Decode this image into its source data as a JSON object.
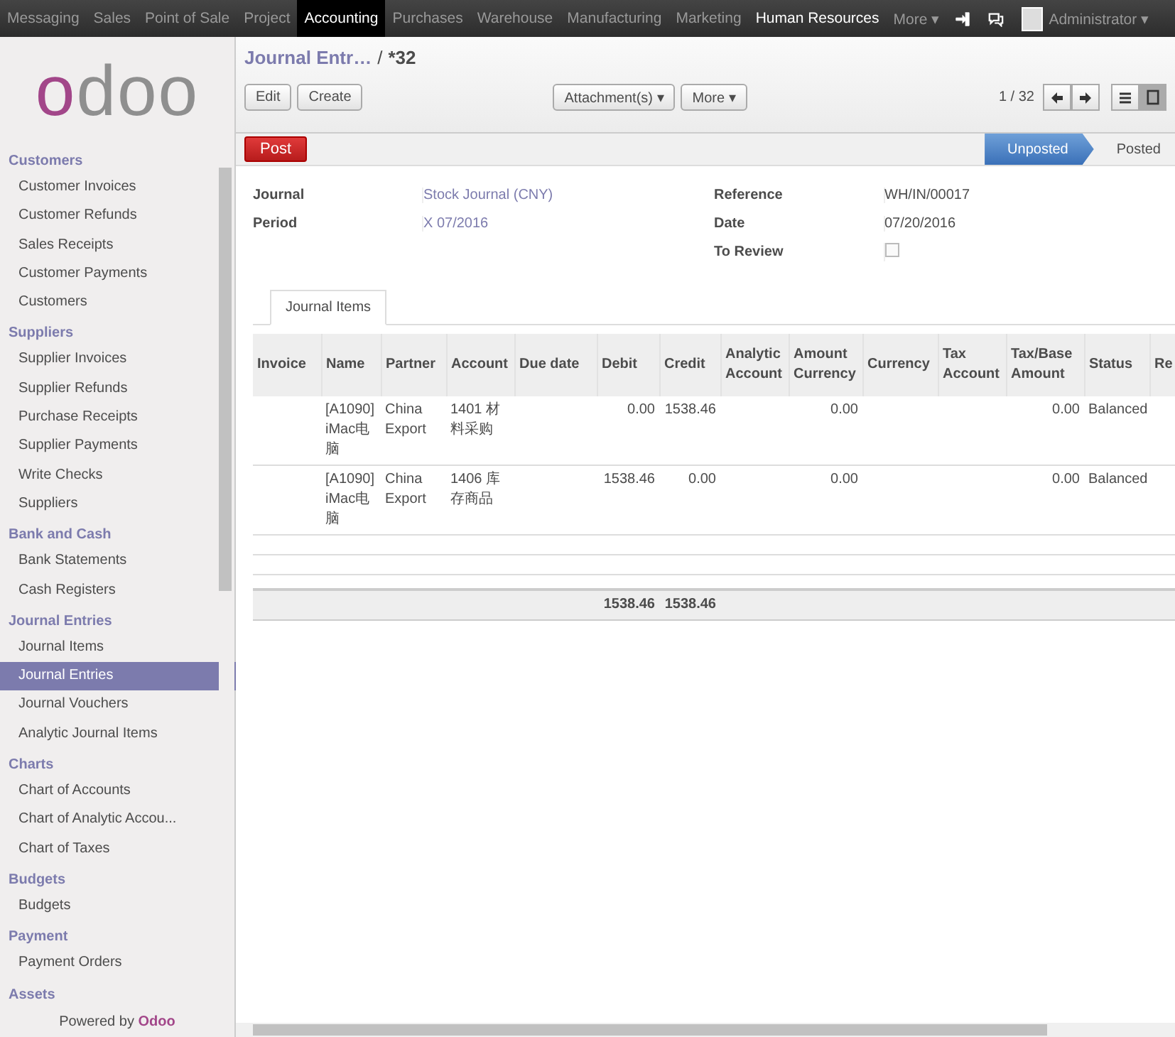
{
  "top_menu": [
    {
      "label": "Messaging",
      "selected": false,
      "highlighted": false
    },
    {
      "label": "Sales",
      "selected": false,
      "highlighted": false
    },
    {
      "label": "Point of Sale",
      "selected": false,
      "highlighted": false
    },
    {
      "label": "Project",
      "selected": false,
      "highlighted": false
    },
    {
      "label": "Accounting",
      "selected": true,
      "highlighted": true
    },
    {
      "label": "Purchases",
      "selected": false,
      "highlighted": false
    },
    {
      "label": "Warehouse",
      "selected": false,
      "highlighted": false
    },
    {
      "label": "Manufacturing",
      "selected": false,
      "highlighted": false
    },
    {
      "label": "Marketing",
      "selected": false,
      "highlighted": false
    },
    {
      "label": "Human Resources",
      "selected": false,
      "highlighted": true
    },
    {
      "label": "More ▾",
      "selected": false,
      "highlighted": false
    }
  ],
  "user": {
    "name": "Administrator ▾"
  },
  "logo": {
    "accent": "o",
    "rest": "doo"
  },
  "sidebar": [
    {
      "title": "Customers",
      "items": [
        {
          "label": "Customer Invoices",
          "selected": false
        },
        {
          "label": "Customer Refunds",
          "selected": false
        },
        {
          "label": "Sales Receipts",
          "selected": false
        },
        {
          "label": "Customer Payments",
          "selected": false
        },
        {
          "label": "Customers",
          "selected": false
        }
      ]
    },
    {
      "title": "Suppliers",
      "items": [
        {
          "label": "Supplier Invoices",
          "selected": false
        },
        {
          "label": "Supplier Refunds",
          "selected": false
        },
        {
          "label": "Purchase Receipts",
          "selected": false
        },
        {
          "label": "Supplier Payments",
          "selected": false
        },
        {
          "label": "Write Checks",
          "selected": false
        },
        {
          "label": "Suppliers",
          "selected": false
        }
      ]
    },
    {
      "title": "Bank and Cash",
      "items": [
        {
          "label": "Bank Statements",
          "selected": false
        },
        {
          "label": "Cash Registers",
          "selected": false
        }
      ]
    },
    {
      "title": "Journal Entries",
      "items": [
        {
          "label": "Journal Items",
          "selected": false
        },
        {
          "label": "Journal Entries",
          "selected": true
        },
        {
          "label": "Journal Vouchers",
          "selected": false
        },
        {
          "label": "Analytic Journal Items",
          "selected": false
        }
      ]
    },
    {
      "title": "Charts",
      "items": [
        {
          "label": "Chart of Accounts",
          "selected": false
        },
        {
          "label": "Chart of Analytic Accou...",
          "selected": false
        },
        {
          "label": "Chart of Taxes",
          "selected": false
        }
      ]
    },
    {
      "title": "Budgets",
      "items": [
        {
          "label": "Budgets",
          "selected": false
        }
      ]
    },
    {
      "title": "Payment",
      "items": [
        {
          "label": "Payment Orders",
          "selected": false
        }
      ]
    },
    {
      "title": "Assets"
    }
  ],
  "powered_by": {
    "text": "Powered by",
    "brand": "Odoo"
  },
  "breadcrumb": {
    "parent": "Journal Entr…",
    "separator": "/",
    "current": "*32"
  },
  "buttons_left": [
    "Edit",
    "Create"
  ],
  "buttons_mid": [
    "Attachment(s) ▾",
    "More ▾"
  ],
  "pager": "1 / 32",
  "post_button": "Post",
  "states": [
    {
      "label": "Unposted",
      "selected": true
    },
    {
      "label": "Posted",
      "selected": false
    }
  ],
  "fields_left": [
    {
      "label": "Journal",
      "value": "Stock Journal (CNY)"
    },
    {
      "label": "Period",
      "value": "X 07/2016"
    }
  ],
  "fields_right": [
    {
      "label": "Reference",
      "value": "WH/IN/00017"
    },
    {
      "label": "Date",
      "value": "07/20/2016"
    },
    {
      "label": "To Review",
      "checked": false
    }
  ],
  "tab": "Journal Items",
  "table": {
    "columns": [
      "Invoice",
      "Name",
      "Partner",
      "Account",
      "Due date",
      "Debit",
      "Credit",
      "Analytic Account",
      "Amount Currency",
      "Currency",
      "Tax Account",
      "Tax/Base Amount",
      "Status",
      "Re"
    ],
    "rows": [
      [
        "",
        "[A1090] iMac电脑",
        "China Export",
        "1401 材料采购",
        "",
        "0.00",
        "1538.46",
        "",
        "0.00",
        "",
        "",
        "0.00",
        "Balanced",
        ""
      ],
      [
        "",
        "[A1090] iMac电脑",
        "China Export",
        "1406 库存商品",
        "",
        "1538.46",
        "0.00",
        "",
        "0.00",
        "",
        "",
        "0.00",
        "Balanced",
        ""
      ]
    ],
    "totals": {
      "debit": "1538.46",
      "credit": "1538.46"
    }
  }
}
